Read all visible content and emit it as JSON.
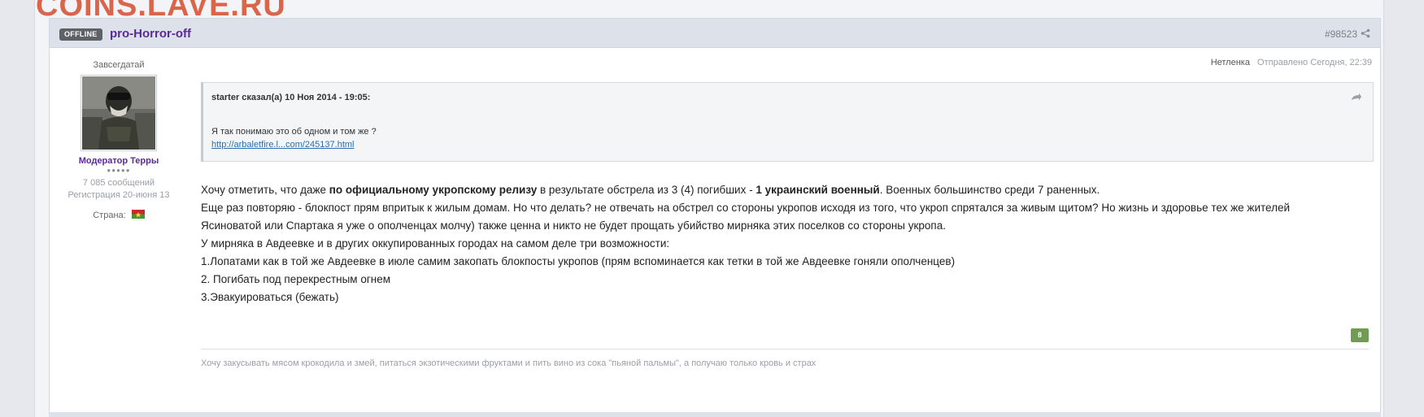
{
  "watermark": "COINS.LAVE.RU",
  "header": {
    "status_badge": "OFFLINE",
    "author": "pro-Horror-off",
    "post_id": "#98523",
    "icons": [
      "share-icon"
    ]
  },
  "user": {
    "title": "Завсегдатай",
    "group": "Модератор Терры",
    "pips": "●●●●●",
    "messages": "7 085 сообщений",
    "registered": "Регистрация 20-июня 13",
    "country_label": "Страна:"
  },
  "meta": {
    "author_nick": "Нетленка",
    "sent": "Отправлено Сегодня, 22:39"
  },
  "quote": {
    "header": "starter сказал(а) 10 Ноя 2014 - 19:05:",
    "text": "Я так понимаю это об одном и том же ?",
    "link": "http://arbaletfire.l...com/245137.html"
  },
  "body": {
    "p1_a": "Хочу отметить, что даже ",
    "p1_b": "по официальному укропскому релизу",
    "p1_c": " в результате обстрела из 3 (4) погибших - ",
    "p1_d": "1 украинский военный",
    "p1_e": ". Военных большинство среди 7 раненных.",
    "p2": "Еще раз повторяю - блокпост прям впритык к жилым домам. Но что делать? не отвечать на обстрел со стороны укропов исходя из того, что укроп спрятался за живым щитом? Но жизнь и здоровье тех же жителей",
    "p3": "Ясиноватой или Спартака я уже о ополченцах молчу) также ценна и никто не будет прощать убийство мирняка этих поселков со стороны укропа.",
    "p4": "У мирняка в Авдеевке и в других оккупированных городах на самом деле три возможности:",
    "p5": "1.Лопатами как в той же Авдеевке в июле самим закопать блокпосты укропов (прям вспоминается как тетки в той же Авдеевке гоняли ополченцев)",
    "p6": "2. Погибать под перекрестным огнем",
    "p7": "3.Эвакуироваться (бежать)"
  },
  "reputation": "8",
  "signature": "Хочу закусывать мясом крокодила и змей, питаться экзотическими фруктами и пить вино из сока \"пьяной пальмы\", а получаю только кровь и страх",
  "colors": {
    "author": "#5a2a99",
    "link": "#2a6db0",
    "rep": "#6f9b55",
    "header_bg": "#dde1ea"
  }
}
